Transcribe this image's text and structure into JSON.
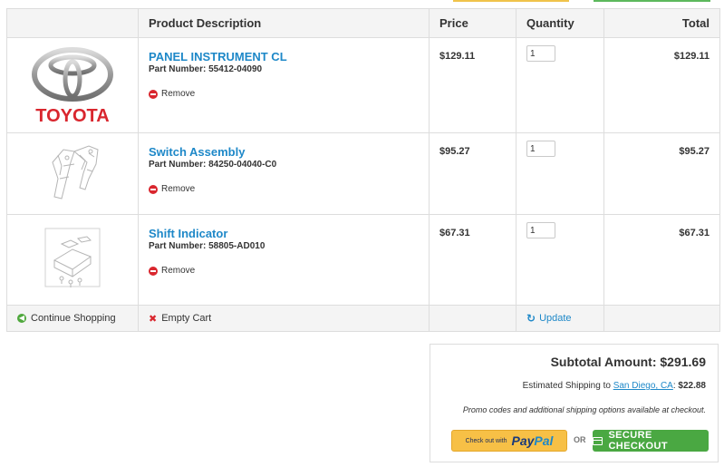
{
  "header": {
    "product": "Product Description",
    "price": "Price",
    "quantity": "Quantity",
    "total": "Total"
  },
  "items": [
    {
      "name": "PANEL INSTRUMENT CL",
      "part": "Part Number: 55412-04090",
      "remove": "Remove",
      "price": "$129.11",
      "qty": "1",
      "total": "$129.11",
      "image": "toyota-logo",
      "logo_text": "TOYOTA"
    },
    {
      "name": "Switch Assembly",
      "part": "Part Number: 84250-04040-C0",
      "remove": "Remove",
      "price": "$95.27",
      "qty": "1",
      "total": "$95.27",
      "image": "switch-assembly-drawing"
    },
    {
      "name": "Shift Indicator",
      "part": "Part Number: 58805-AD010",
      "remove": "Remove",
      "price": "$67.31",
      "qty": "1",
      "total": "$67.31",
      "image": "shift-indicator-drawing"
    }
  ],
  "footer": {
    "continue": "Continue Shopping",
    "empty": "Empty Cart",
    "update": "Update"
  },
  "summary": {
    "subtotal": "Subtotal Amount: $291.69",
    "shipping_prefix": "Estimated Shipping to ",
    "shipping_city": "San Diego, CA",
    "shipping_amount": "$22.88",
    "promo": "Promo codes and additional shipping options available at checkout.",
    "paypal_prefix": "Check out with",
    "paypal_pay": "Pay",
    "paypal_pal": "Pal",
    "or": "OR",
    "checkout": "SECURE CHECKOUT"
  },
  "colors": {
    "link": "#1e88c8",
    "remove_red": "#d9262e",
    "checkout_green": "#4aa842",
    "paypal_yellow": "#f7c046",
    "toyota_red": "#d9262e"
  }
}
